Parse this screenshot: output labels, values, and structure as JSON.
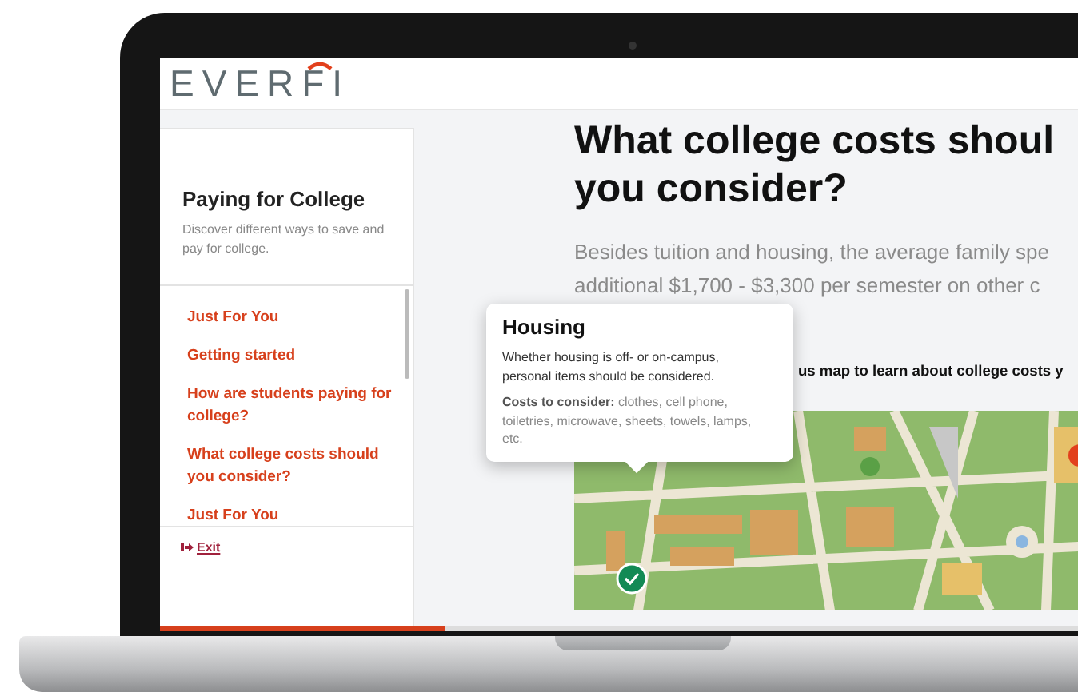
{
  "logo": {
    "text": "EVERFI"
  },
  "sidebar": {
    "title": "Paying for College",
    "description": "Discover different ways to save and pay for college.",
    "items": [
      {
        "label": "Just For You"
      },
      {
        "label": "Getting started"
      },
      {
        "label": "How are students paying for college?"
      },
      {
        "label": "What college costs should you consider?"
      },
      {
        "label": "Just For You"
      }
    ],
    "exit": "Exit"
  },
  "main": {
    "heading_lines": [
      "What college costs shoul",
      "you consider?"
    ],
    "intro_lines": [
      "Besides tuition and housing, the average family spe",
      "additional $1,700 - $3,300 per semester on other c"
    ],
    "instruction": "us map to learn about college costs y"
  },
  "tooltip": {
    "title": "Housing",
    "text": "Whether housing is off- or on-campus, personal items should be considered.",
    "costs": "**Costs to consider:** clothes, cell phone, toiletries, microwave, sheets, towels, lamps, etc."
  },
  "progress": {
    "level": 0.31
  }
}
